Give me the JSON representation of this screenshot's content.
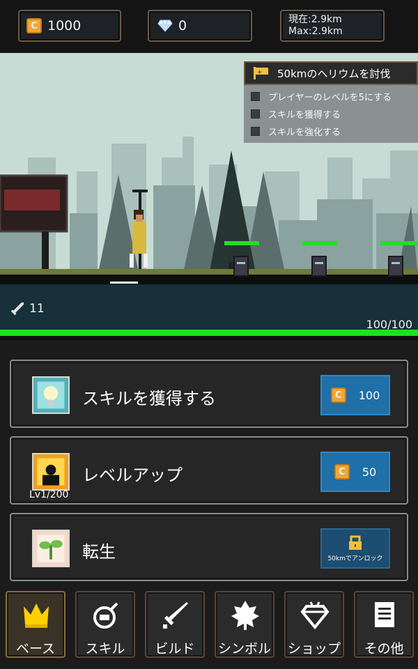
{
  "resources": {
    "coins": "1000",
    "gems": "0",
    "distance_current": "現在:2.9km",
    "distance_max": "Max:2.9km"
  },
  "quest": {
    "title": "50kmのヘリウムを討伐",
    "tasks": [
      "プレイヤーのレベルを5にする",
      "スキルを獲得する",
      "スキルを強化する"
    ]
  },
  "player": {
    "attack": "11",
    "hp": "100/100",
    "hp_fraction": 1.0
  },
  "actions": [
    {
      "label": "スキルを獲得する",
      "price": "100",
      "icon": "lightbulb-icon"
    },
    {
      "label": "レベルアップ",
      "price": "50",
      "level": "Lv1/200",
      "icon": "character-silhouette-icon"
    },
    {
      "label": "転生",
      "locked_text": "50kmでアンロック",
      "icon": "sprout-icon"
    }
  ],
  "nav": [
    {
      "label": "ベース",
      "icon": "crown-icon"
    },
    {
      "label": "スキル",
      "icon": "bomb-icon"
    },
    {
      "label": "ビルド",
      "icon": "sword-icon"
    },
    {
      "label": "シンボル",
      "icon": "leaf-icon"
    },
    {
      "label": "ショップ",
      "icon": "diamond-icon"
    },
    {
      "label": "その他",
      "icon": "scroll-icon"
    }
  ],
  "colors": {
    "hp_bar": "#20e020",
    "buy_button": "#1f6fa8",
    "coin": "#f0a63a",
    "frame": "#6b5a44"
  }
}
